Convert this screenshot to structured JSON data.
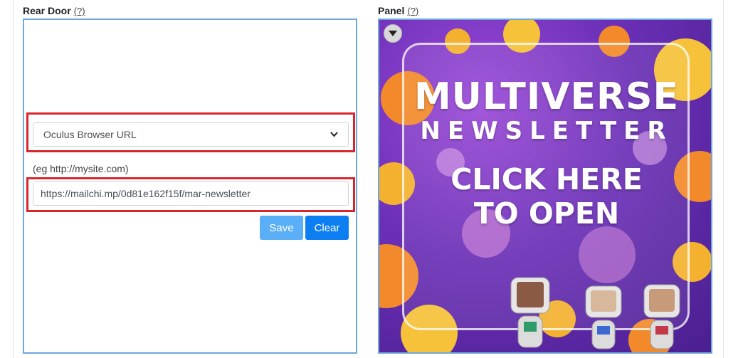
{
  "rear_door": {
    "label": "Rear Door",
    "help": "(?)",
    "link_type": "Oculus Browser URL",
    "hint": "(eg http://mysite.com)",
    "url": "https://mailchi.mp/0d81e162f15f/mar-newsletter",
    "save_label": "Save",
    "clear_label": "Clear"
  },
  "panel": {
    "label": "Panel",
    "help": "(?)",
    "image": {
      "title_line1": "MULTIVERSE",
      "title_line2": "NEWSLETTER",
      "cta_line1": "CLICK HERE",
      "cta_line2": "TO OPEN"
    }
  },
  "colors": {
    "highlight": "#d9262b",
    "box_border": "#6fa8dc",
    "save_button": "#5aaff7",
    "clear_button": "#0d7ef2"
  }
}
